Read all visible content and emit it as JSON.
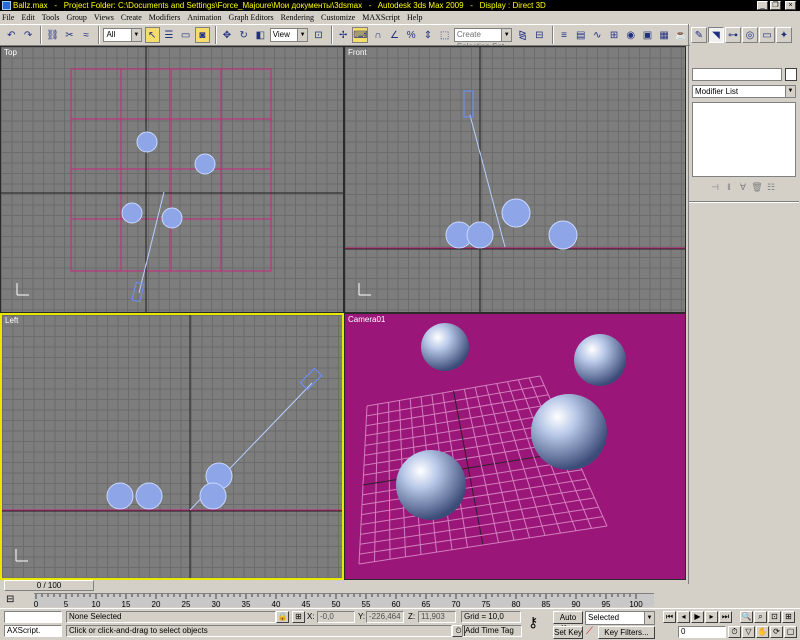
{
  "window": {
    "file": "Ballz.max",
    "project_folder": "Project Folder: C:\\Documents and Settings\\Force_Majoure\\Мои документы\\3dsmax",
    "app": "Autodesk 3ds Max  2009",
    "display": "Display : Direct 3D"
  },
  "menu": [
    "File",
    "Edit",
    "Tools",
    "Group",
    "Views",
    "Create",
    "Modifiers",
    "Animation",
    "Graph Editors",
    "Rendering",
    "Customize",
    "MAXScript",
    "Help"
  ],
  "toolbar": {
    "selection_filter": "All",
    "reference_coord": "View",
    "named_selection_placeholder": "Create Selection Set"
  },
  "command_panel": {
    "modifier_list": "Modifier List"
  },
  "viewports": {
    "top": {
      "label": "Top"
    },
    "front": {
      "label": "Front"
    },
    "left": {
      "label": "Left"
    },
    "camera": {
      "label": "Camera01"
    }
  },
  "colors": {
    "viewport_bg": "#7d7d7d",
    "camera_bg": "#9b1679",
    "grid_pink": "#c8287c",
    "wire_blue": "#a8c4ff",
    "active_border": "#e8e800"
  },
  "timeline": {
    "slider_text": "0 / 100",
    "ticks": [
      "0",
      "5",
      "10",
      "15",
      "20",
      "25",
      "30",
      "35",
      "40",
      "45",
      "50",
      "55",
      "60",
      "65",
      "70",
      "75",
      "80",
      "85",
      "90",
      "95",
      "100"
    ]
  },
  "status": {
    "maxscript": "AXScript.",
    "selection": "None Selected",
    "prompt": "Click or click-and-drag to select objects",
    "x_label": "X:",
    "x_value": "-0,0",
    "y_label": "Y:",
    "y_value": "-226,464",
    "z_label": "Z:",
    "z_value": "11,903",
    "grid": "Grid = 10,0",
    "add_time_tag": "Add Time Tag",
    "auto_key": "Auto Key",
    "set_key": "Set Key",
    "key_mode": "Selected",
    "key_filters": "Key Filters...",
    "frame": "0"
  }
}
